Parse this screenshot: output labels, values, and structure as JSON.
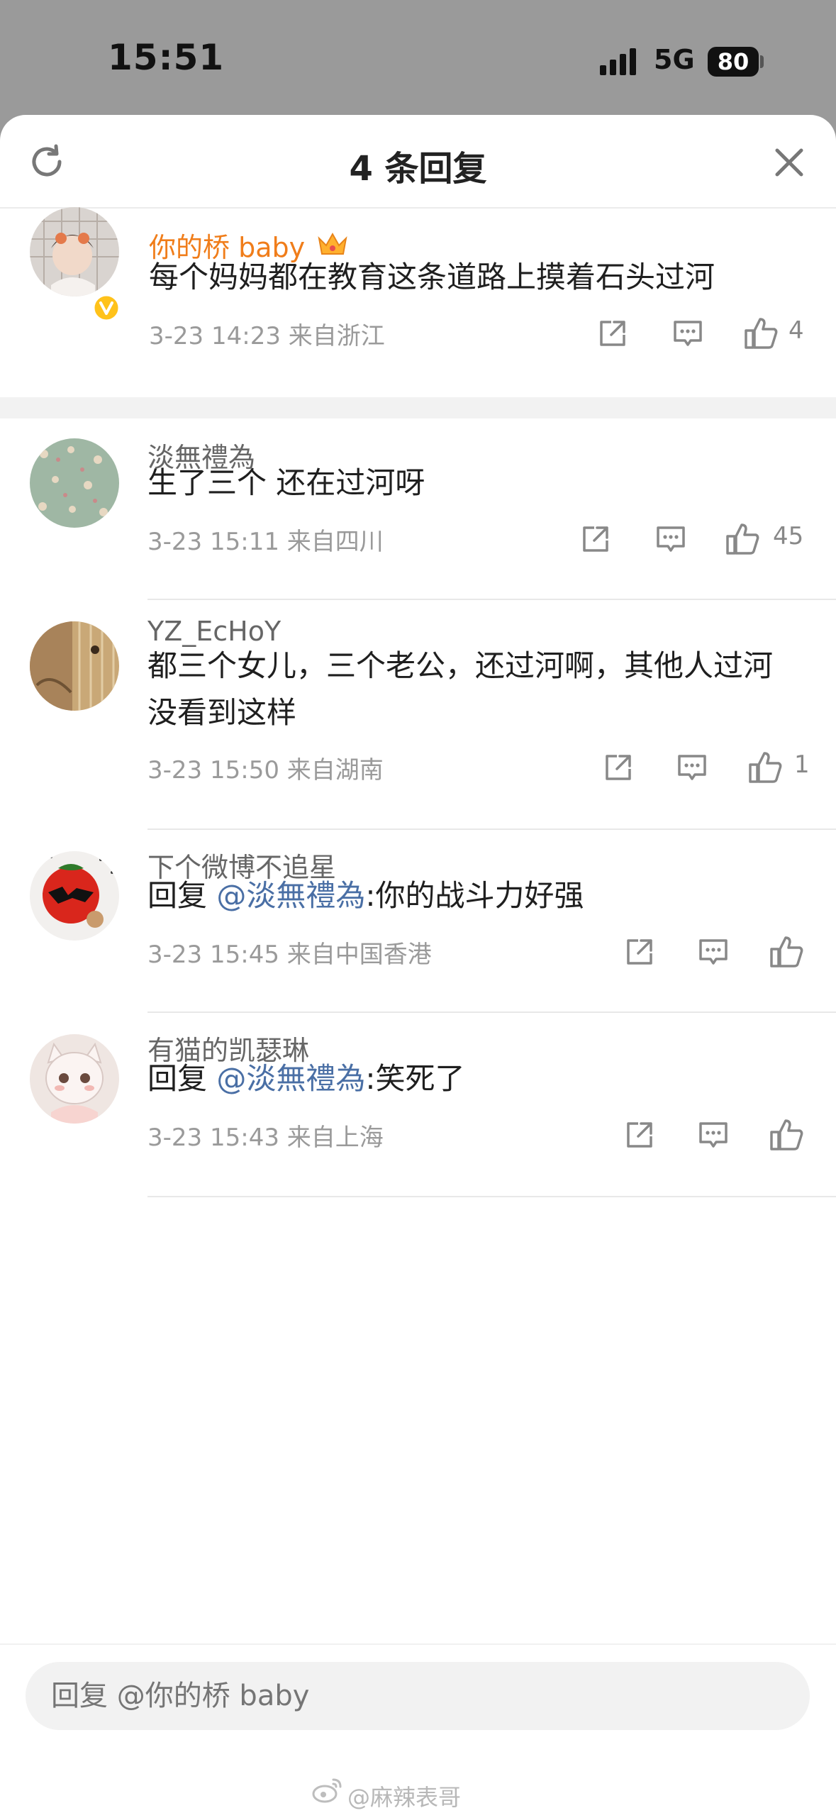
{
  "status_bar": {
    "time": "15:51",
    "network": "5G",
    "battery": "80"
  },
  "header": {
    "title": "4 条回复"
  },
  "main_comment": {
    "username": "你的桥 baby",
    "text": "每个妈妈都在教育这条道路上摸着石头过河",
    "meta": "3-23 14:23  来自浙江",
    "likes": "4"
  },
  "replies": [
    {
      "username": "淡無禮為",
      "text": "生了三个 还在过河呀",
      "meta": "3-23 15:11  来自四川",
      "likes": "45"
    },
    {
      "username": "YZ_EcHoY",
      "text": "都三个女儿，三个老公，还过河啊，其他人过河没看到这样",
      "meta": "3-23 15:50  来自湖南",
      "likes": "1"
    },
    {
      "username": "下个微博不追星",
      "reply_prefix": "回复 ",
      "mention": "@淡無禮為",
      "text": ":你的战斗力好强",
      "meta": "3-23 15:45  来自中国香港",
      "likes": ""
    },
    {
      "username": "有猫的凯瑟琳",
      "reply_prefix": "回复 ",
      "mention": "@淡無禮為",
      "text": ":笑死了",
      "meta": "3-23 15:43  来自上海",
      "likes": ""
    }
  ],
  "footer": {
    "reply_placeholder": "回复 @你的桥 baby",
    "watermark": "@麻辣表哥"
  },
  "colors": {
    "username_vip": "#f07d1a",
    "mention": "#4a6fa5",
    "meta": "#9a9a9a"
  }
}
